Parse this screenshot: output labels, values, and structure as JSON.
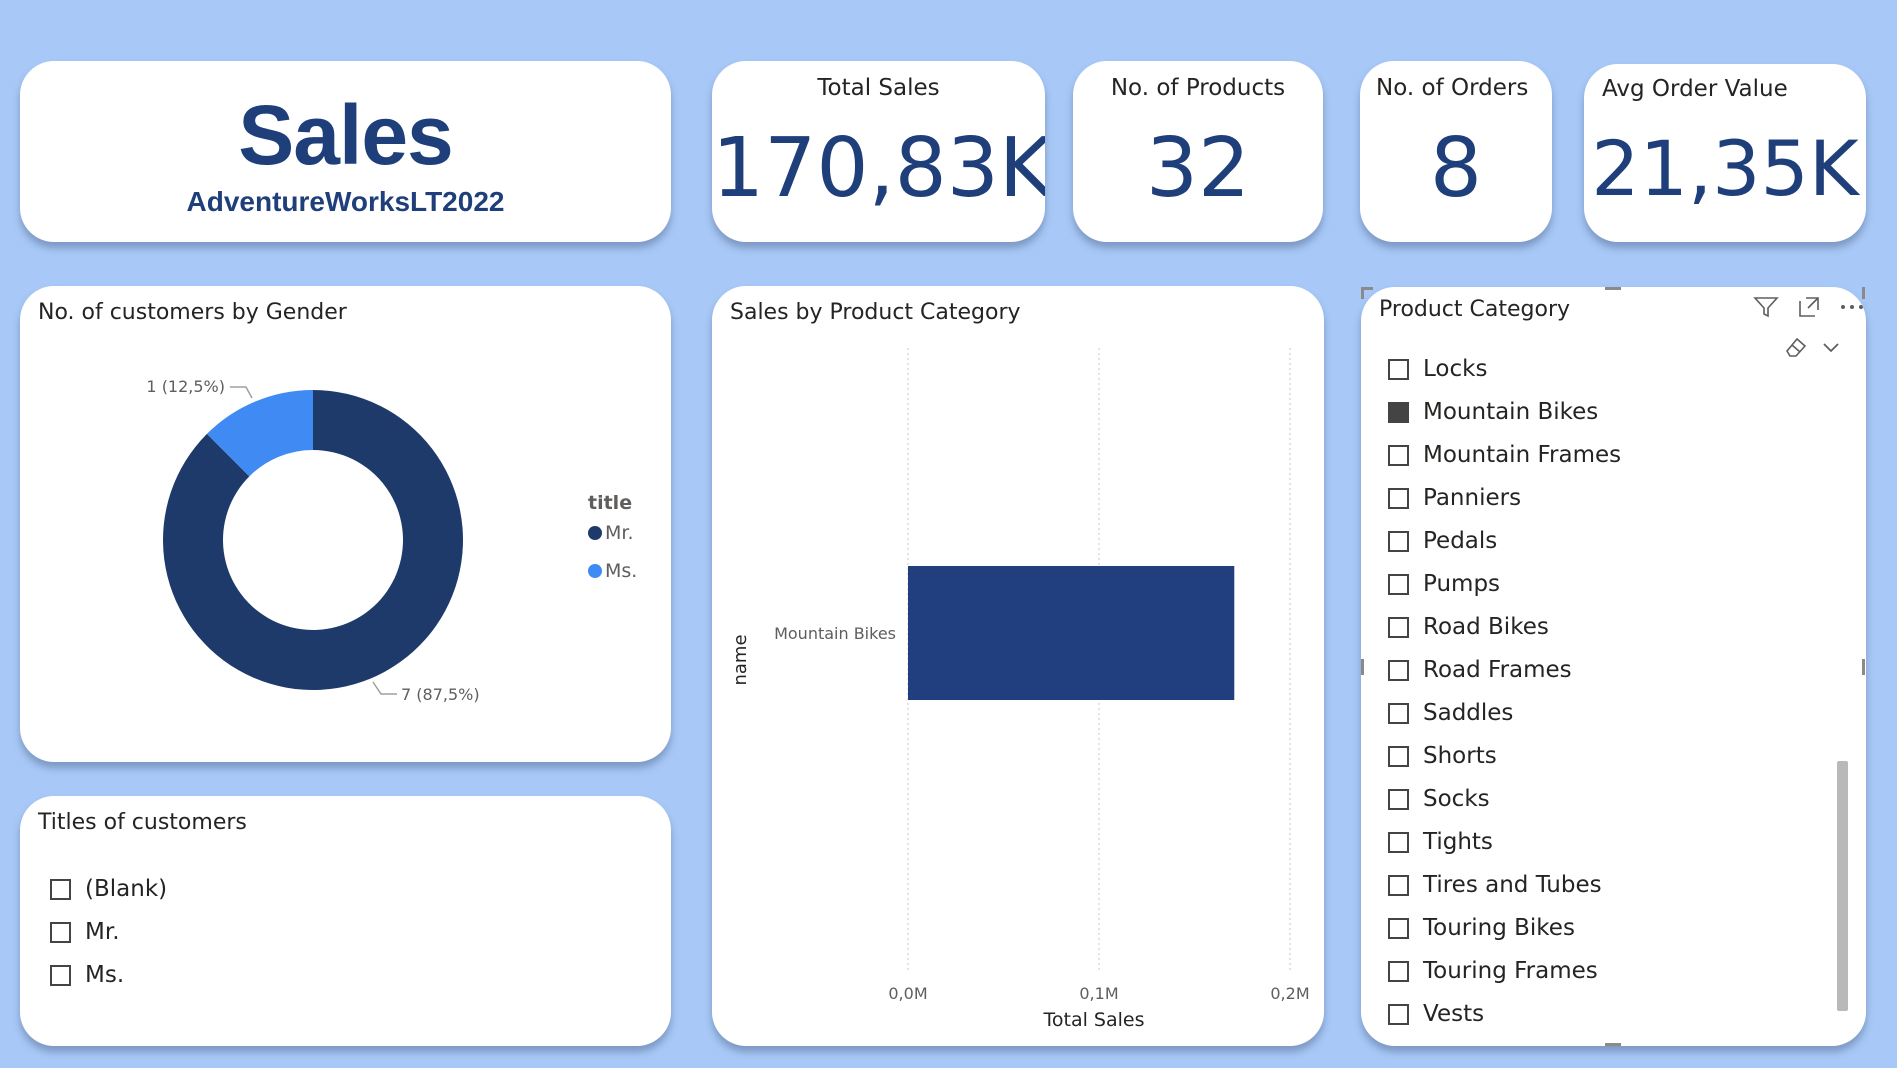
{
  "header": {
    "title": "Sales",
    "subtitle": "AdventureWorksLT2022"
  },
  "kpis": {
    "total_sales": {
      "label": "Total Sales",
      "value": "170,83K"
    },
    "num_products": {
      "label": "No. of Products",
      "value": "32"
    },
    "num_orders": {
      "label": "No. of Orders",
      "value": "8"
    },
    "avg_order_value": {
      "label": "Avg Order Value",
      "value": "21,35K"
    }
  },
  "donut_panel": {
    "title": "No. of customers by Gender",
    "label_ms": "1 (12,5%)",
    "label_mr": "7 (87,5%)",
    "legend_title": "title",
    "legend": [
      "Mr.",
      "Ms."
    ]
  },
  "bar_panel": {
    "title": "Sales by Product Category"
  },
  "titles_panel": {
    "title": "Titles of customers",
    "items": [
      "(Blank)",
      "Mr.",
      "Ms."
    ]
  },
  "slicer": {
    "title": "Product Category",
    "selected": "Mountain Bikes",
    "items": [
      "Locks",
      "Mountain Bikes",
      "Mountain Frames",
      "Panniers",
      "Pedals",
      "Pumps",
      "Road Bikes",
      "Road Frames",
      "Saddles",
      "Shorts",
      "Socks",
      "Tights",
      "Tires and Tubes",
      "Touring Bikes",
      "Touring Frames",
      "Vests"
    ]
  },
  "colors": {
    "background": "#a8c9f7",
    "accent_dark": "#1f3f7a",
    "series_mr": "#1d3a6b",
    "series_ms": "#3f8bf3",
    "bar": "#213f7e"
  },
  "chart_data": [
    {
      "type": "pie",
      "title": "No. of customers by Gender",
      "legend_title": "title",
      "categories": [
        "Mr.",
        "Ms."
      ],
      "values": [
        7,
        1
      ],
      "percent_labels": [
        "87,5%",
        "12,5%"
      ],
      "legend_position": "right"
    },
    {
      "type": "bar",
      "orientation": "horizontal",
      "title": "Sales by Product Category",
      "categories": [
        "Mountain Bikes"
      ],
      "values": [
        170830
      ],
      "xlabel": "Total Sales",
      "ylabel": "name",
      "xlim": [
        0,
        200000
      ],
      "x_ticks": [
        0,
        100000,
        200000
      ],
      "x_tick_labels": [
        "0,0M",
        "0,1M",
        "0,2M"
      ],
      "grid": true
    }
  ]
}
